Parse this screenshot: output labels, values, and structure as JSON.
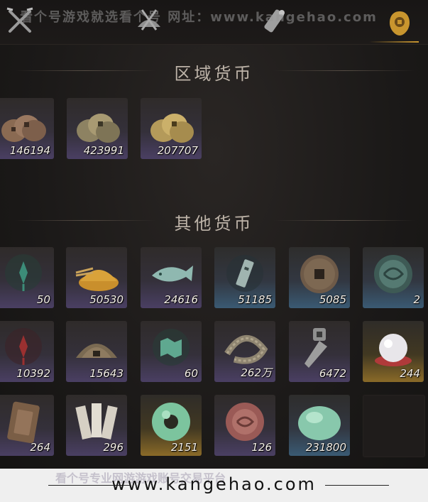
{
  "watermark_top": "看个号游戏就选看个号   网址：www.kangehao.com",
  "sections": {
    "regional": "区域货币",
    "other": "其他货币"
  },
  "regional_items": [
    {
      "name": "copper-coin-stack-icon",
      "count": "146194"
    },
    {
      "name": "bronze-coin-stack-icon",
      "count": "423991"
    },
    {
      "name": "gold-coin-stack-icon",
      "count": "207707"
    }
  ],
  "other_items": [
    {
      "name": "jade-pendant-icon",
      "count": "50"
    },
    {
      "name": "grain-pile-icon",
      "count": "50530"
    },
    {
      "name": "jade-fish-icon",
      "count": "24616"
    },
    {
      "name": "token-tablet-icon",
      "count": "51185"
    },
    {
      "name": "square-hole-coin-icon",
      "count": "5085"
    },
    {
      "name": "carved-stone-disc-icon",
      "count": "2"
    },
    {
      "name": "red-pendant-icon",
      "count": "10392"
    },
    {
      "name": "half-round-coin-icon",
      "count": "15643"
    },
    {
      "name": "jade-map-icon",
      "count": "60"
    },
    {
      "name": "coin-string-icon",
      "count": "262万"
    },
    {
      "name": "spade-coin-icon",
      "count": "6472"
    },
    {
      "name": "pearl-icon",
      "count": "244"
    },
    {
      "name": "bronze-plaque-icon",
      "count": "264"
    },
    {
      "name": "paper-slips-icon",
      "count": "296"
    },
    {
      "name": "jade-ring-icon",
      "count": "2151"
    },
    {
      "name": "red-stone-disc-icon",
      "count": "126"
    },
    {
      "name": "jade-stone-icon",
      "count": "231800"
    }
  ],
  "footer": {
    "url": "www.kangehao.com",
    "watermark": "看个号专业网游游戏账号交易平台"
  },
  "colors": {
    "tile_purple": "#4a3f63",
    "tile_blue": "#3a5a73",
    "tile_gold": "#8a6a28"
  }
}
